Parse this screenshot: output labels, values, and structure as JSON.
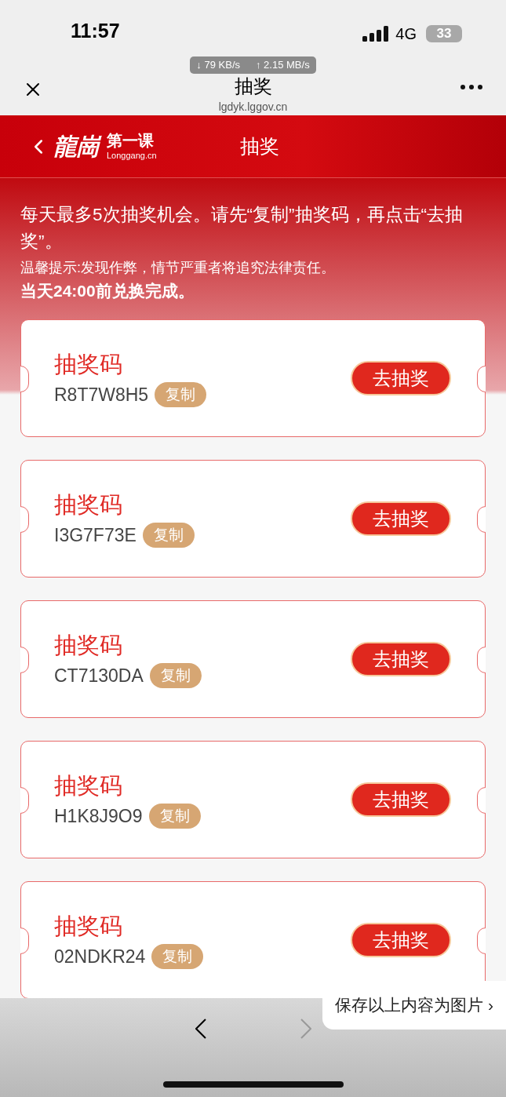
{
  "status_bar": {
    "time": "11:57",
    "network": "4G",
    "battery": "33"
  },
  "speed_badge": {
    "download": "↓ 79 KB/s",
    "upload": "↑ 2.15 MB/s"
  },
  "browser_bar": {
    "title": "抽奖",
    "url": "lgdyk.lggov.cn"
  },
  "header": {
    "logo": "龍崗",
    "logo_sub": "第一课",
    "logo_domain": "Longgang.cn",
    "title": "抽奖"
  },
  "notice": {
    "rules": "每天最多5次抽奖机会。请先“复制”抽奖码，再点击“去抽奖”。",
    "warning": "温馨提示:发现作弊，情节严重者将追究法律责任。",
    "deadline": "当天24:00前兑换完成。"
  },
  "tickets": [
    {
      "label": "抽奖码",
      "code": "R8T7W8H5",
      "copy": "复制",
      "action": "去抽奖"
    },
    {
      "label": "抽奖码",
      "code": "I3G7F73E",
      "copy": "复制",
      "action": "去抽奖"
    },
    {
      "label": "抽奖码",
      "code": "CT7130DA",
      "copy": "复制",
      "action": "去抽奖"
    },
    {
      "label": "抽奖码",
      "code": "H1K8J9O9",
      "copy": "复制",
      "action": "去抽奖"
    },
    {
      "label": "抽奖码",
      "code": "02NDKR24",
      "copy": "复制",
      "action": "去抽奖"
    }
  ],
  "save_popup": {
    "label": "保存以上内容为图片 ›"
  },
  "toolbar": {
    "back_enabled": true,
    "forward_enabled": false
  }
}
